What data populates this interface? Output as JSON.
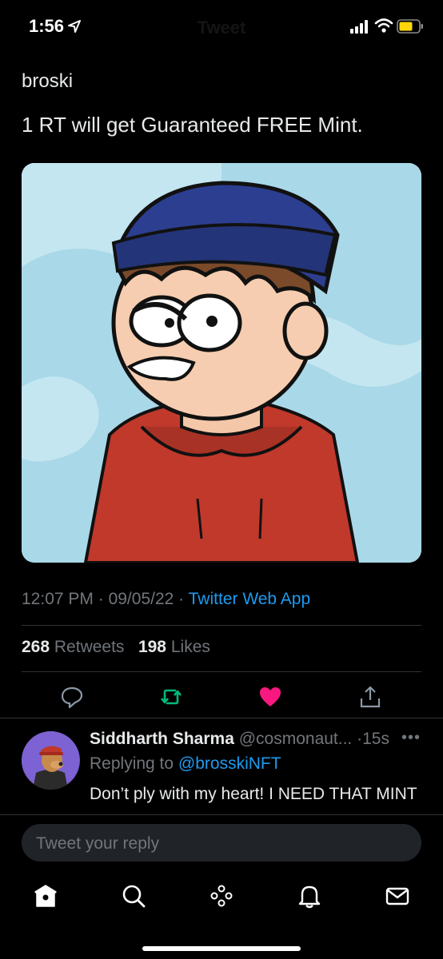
{
  "status_bar": {
    "time": "1:56",
    "faded_title": "Tweet"
  },
  "tweet": {
    "author": "broski",
    "text": "1 RT will get Guaranteed FREE Mint.",
    "time": "12:07 PM",
    "date": "09/05/22",
    "source": "Twitter Web App",
    "retweets_count": "268",
    "retweets_label": "Retweets",
    "likes_count": "198",
    "likes_label": "Likes"
  },
  "actions": {
    "reply_icon": "comment-icon",
    "retweet_icon": "retweet-icon",
    "like_icon": "heart-icon",
    "share_icon": "share-icon"
  },
  "reply": {
    "name": "Siddharth Sharma",
    "handle": "@cosmonaut...",
    "time": "15s",
    "replying_prefix": "Replying to",
    "replying_to": "@brosskiNFT",
    "text": "Don’t ply with my heart! I NEED THAT MINT"
  },
  "composer": {
    "placeholder": "Tweet your reply"
  },
  "tabbar": [
    "home-icon",
    "search-icon",
    "spaces-icon",
    "notifications-icon",
    "messages-icon"
  ],
  "colors": {
    "background": "#000000",
    "link": "#1d9bf0",
    "muted": "#71767b",
    "like": "#f91880",
    "retweet": "#00ba7c"
  }
}
